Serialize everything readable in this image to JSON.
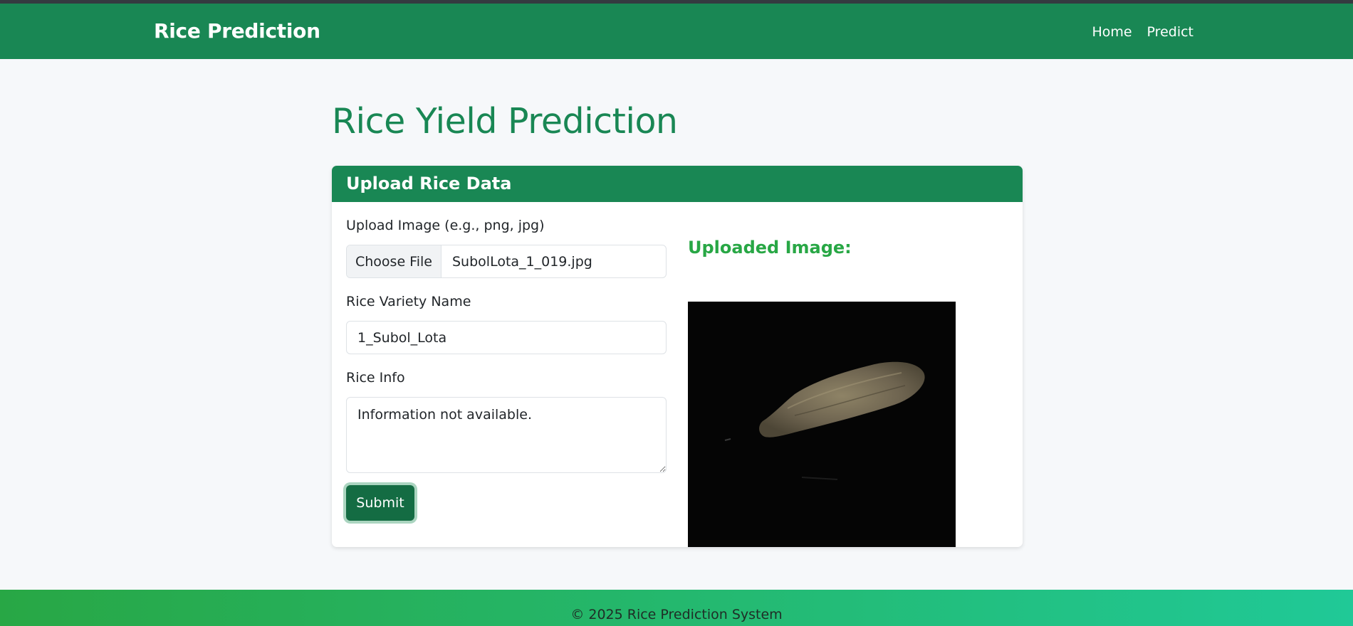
{
  "navbar": {
    "brand": "Rice Prediction",
    "links": [
      "Home",
      "Predict"
    ]
  },
  "page": {
    "title": "Rice Yield Prediction"
  },
  "card": {
    "header": "Upload Rice Data",
    "form": {
      "image_label": "Upload Image (e.g., png, jpg)",
      "file_button": "Choose File",
      "file_name": "SubolLota_1_019.jpg",
      "variety_label": "Rice Variety Name",
      "variety_value": "1_Subol_Lota",
      "info_label": "Rice Info",
      "info_value": "Information not available.",
      "submit_label": "Submit"
    },
    "preview": {
      "title": "Uploaded Image:"
    }
  },
  "footer": {
    "text": "© 2025 Rice Prediction System"
  },
  "colors": {
    "brand_green": "#198754",
    "preview_title_green": "#28a745",
    "footer_gradient_start": "#28a745",
    "footer_gradient_end": "#20c997"
  }
}
